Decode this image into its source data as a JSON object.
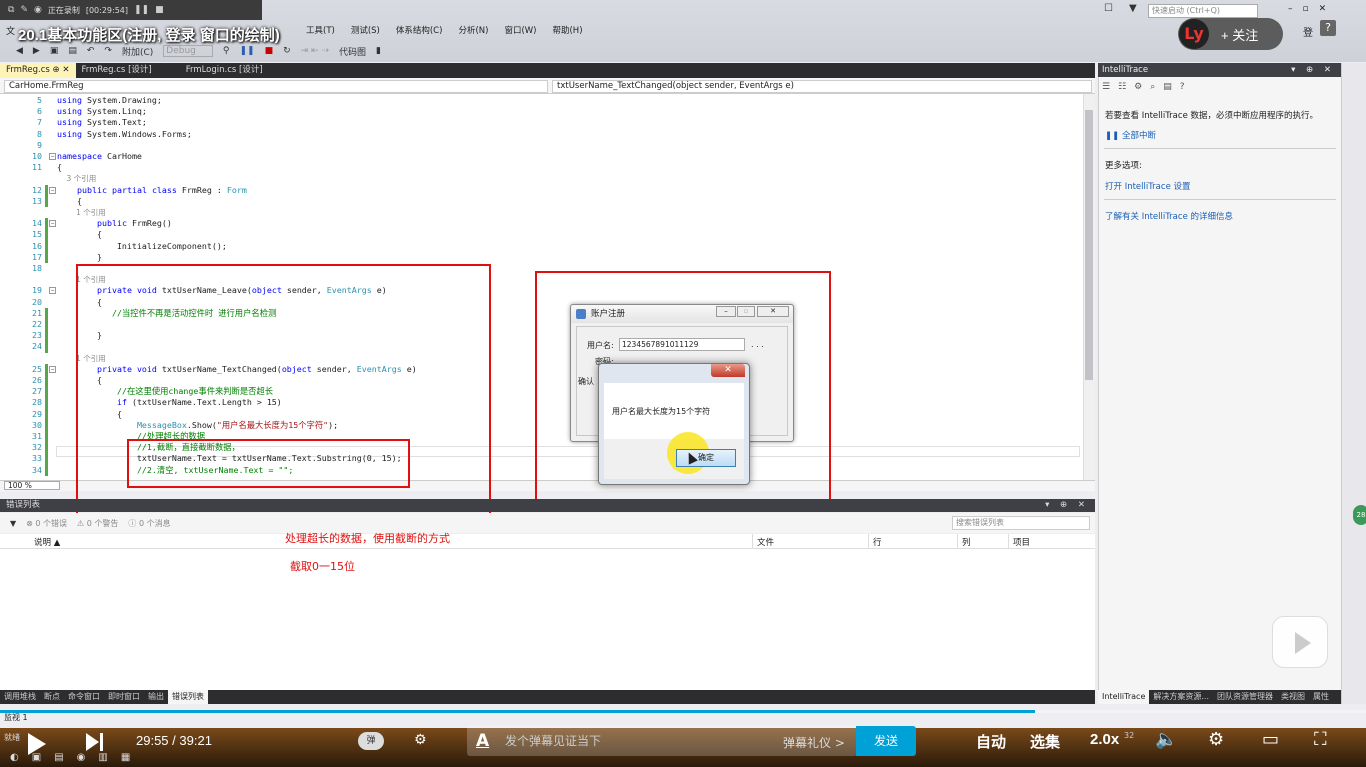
{
  "recorder": {
    "status": "正在录制",
    "elapsed": "[00:29:54]"
  },
  "video_title": "20.1基本功能区(注册, 登录 窗口的绘制)",
  "follow": {
    "avatar_text": "Ly",
    "label": "+ 关注"
  },
  "menu": [
    "工具(T)",
    "测试(S)",
    "体系结构(C)",
    "分析(N)",
    "窗口(W)",
    "帮助(H)"
  ],
  "menu_left": "文",
  "quick_launch": "快速启动 (Ctrl+Q)",
  "login": "登",
  "toolbar": {
    "attach": "附加(C)",
    "config": "Debug",
    "codemap": "代码图"
  },
  "doc_tabs": [
    "FrmReg.cs",
    "FrmReg.cs [设计]",
    "FrmLogin.cs [设计]"
  ],
  "nav": {
    "class": "CarHome.FrmReg",
    "member": "txtUserName_TextChanged(object sender, EventArgs e)"
  },
  "code_lines": [
    {
      "n": "5",
      "t": "using System.Drawing;"
    },
    {
      "n": "6",
      "t": "using System.Linq;"
    },
    {
      "n": "7",
      "t": "using System.Text;"
    },
    {
      "n": "8",
      "t": "using System.Windows.Forms;"
    },
    {
      "n": "9",
      "t": ""
    },
    {
      "n": "10",
      "t": "namespace CarHome"
    },
    {
      "n": "11",
      "t": "{"
    },
    {
      "n": "",
      "t": "    3 个引用"
    },
    {
      "n": "12",
      "t": "    public partial class FrmReg : Form"
    },
    {
      "n": "13",
      "t": "    {"
    },
    {
      "n": "",
      "t": "        1 个引用"
    },
    {
      "n": "14",
      "t": "        public FrmReg()"
    },
    {
      "n": "15",
      "t": "        {"
    },
    {
      "n": "16",
      "t": "            InitializeComponent();"
    },
    {
      "n": "17",
      "t": "        }"
    },
    {
      "n": "18",
      "t": ""
    },
    {
      "n": "",
      "t": "        1 个引用"
    },
    {
      "n": "19",
      "t": "        private void txtUserName_Leave(object sender, EventArgs e)"
    },
    {
      "n": "20",
      "t": "        {"
    },
    {
      "n": "21",
      "t": "           //当控件不再是活动控件时 进行用户名检测"
    },
    {
      "n": "22",
      "t": ""
    },
    {
      "n": "23",
      "t": "        }"
    },
    {
      "n": "24",
      "t": ""
    },
    {
      "n": "",
      "t": "        1 个引用"
    },
    {
      "n": "25",
      "t": "        private void txtUserName_TextChanged(object sender, EventArgs e)"
    },
    {
      "n": "26",
      "t": "        {"
    },
    {
      "n": "27",
      "t": "            //在这里使用change事件来判断是否超长"
    },
    {
      "n": "28",
      "t": "            if (txtUserName.Text.Length > 15)"
    },
    {
      "n": "29",
      "t": "            {"
    },
    {
      "n": "30",
      "t": "                MessageBox.Show(\"用户名最大长度为15个字符\");"
    },
    {
      "n": "31",
      "t": "                //处理超长的数据"
    },
    {
      "n": "32",
      "t": "                //1,截断，直接截断数据，"
    },
    {
      "n": "33",
      "t": "                txtUserName.Text = txtUserName.Text.Substring(0, 15);"
    },
    {
      "n": "34",
      "t": "                //2.清空, txtUserName.Text = \"\";"
    }
  ],
  "zoom": "100 %",
  "error_list": {
    "title": "错误列表",
    "errors": "0 个错误",
    "warnings": "0 个警告",
    "messages": "0 个消息",
    "search_placeholder": "搜索错误列表",
    "columns": [
      "说明",
      "文件",
      "行",
      "列",
      "项目"
    ]
  },
  "annotations": [
    "处理超长的数据，使用截断的方式",
    "截取0一15位"
  ],
  "bottom_tabs": [
    "调用堆栈",
    "断点",
    "命令窗口",
    "即时窗口",
    "输出",
    "错误列表"
  ],
  "intellitrace": {
    "title": "IntelliTrace",
    "info": "若要查看 IntelliTrace 数据，必须中断应用程序的执行。",
    "break_all": "全部中断",
    "more_options": "更多选项:",
    "open_settings": "打开 IntelliTrace 设置",
    "learn_more": "了解有关 IntelliTrace 的详细信息"
  },
  "right_tabs": [
    "IntelliTrace",
    "解决方案资源...",
    "团队资源管理器",
    "类视图",
    "属性"
  ],
  "watch": "监视 1",
  "form": {
    "title": "账户注册",
    "user_label": "用户名:",
    "user_value": "1234567891011129",
    "pwd_label": "密码:",
    "confirm_label": "确认",
    "dots": ". . ."
  },
  "msgbox": {
    "text": "用户名最大长度为15个字符",
    "ok": "确定"
  },
  "player": {
    "current": "29:55",
    "total": "39:21",
    "progress": 0.758,
    "danmu_toggle": "弹",
    "danmu_placeholder": "发个弹幕见证当下",
    "etiquette": "弹幕礼仪 >",
    "send": "发送",
    "auto": "自动",
    "episodes": "选集",
    "speed": "2.0x",
    "speed_small": "32",
    "status_left": "就绪"
  },
  "colors": {
    "annotation": "#e01010",
    "accent": "#00a1d6",
    "tab_active": "#fff4b8"
  }
}
